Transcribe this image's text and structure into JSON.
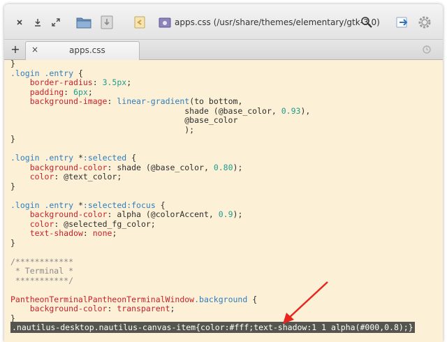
{
  "titlebar": {
    "title": "apps.css (/usr/share/themes/elementary/gtk-3.0)",
    "icons": [
      "close-icon",
      "download-icon",
      "maximize-icon",
      "folder-icon",
      "save-icon",
      "undo-icon",
      "document-icon",
      "search-icon",
      "share-icon",
      "gear-icon"
    ]
  },
  "tabs": {
    "add_label": "+",
    "close_label": "×",
    "active_tab": "apps.css"
  },
  "code_lines": [
    [
      {
        "t": "}",
        "c": "ident"
      }
    ],
    [
      {
        "t": ".login",
        "c": "sel"
      },
      {
        "t": " ",
        "c": "ident"
      },
      {
        "t": ".entry",
        "c": "sel"
      },
      {
        "t": " {",
        "c": "ident"
      }
    ],
    [
      {
        "t": "    ",
        "c": "ident"
      },
      {
        "t": "border-radius",
        "c": "prop"
      },
      {
        "t": ": ",
        "c": "ident"
      },
      {
        "t": "3.5px",
        "c": "num"
      },
      {
        "t": ";",
        "c": "ident"
      }
    ],
    [
      {
        "t": "    ",
        "c": "ident"
      },
      {
        "t": "padding",
        "c": "prop"
      },
      {
        "t": ": ",
        "c": "ident"
      },
      {
        "t": "6px",
        "c": "num"
      },
      {
        "t": ";",
        "c": "ident"
      }
    ],
    [
      {
        "t": "    ",
        "c": "ident"
      },
      {
        "t": "background-image",
        "c": "prop"
      },
      {
        "t": ": ",
        "c": "ident"
      },
      {
        "t": "linear-gradient",
        "c": "fn"
      },
      {
        "t": "(to bottom,",
        "c": "ident"
      }
    ],
    [
      {
        "t": "                                    shade (@base_color, ",
        "c": "ident"
      },
      {
        "t": "0.93",
        "c": "num"
      },
      {
        "t": "),",
        "c": "ident"
      }
    ],
    [
      {
        "t": "                                    @base_color",
        "c": "ident"
      }
    ],
    [
      {
        "t": "                                    );",
        "c": "ident"
      }
    ],
    [
      {
        "t": "}",
        "c": "ident"
      }
    ],
    [
      {
        "t": "",
        "c": "ident"
      }
    ],
    [
      {
        "t": ".login",
        "c": "sel"
      },
      {
        "t": " ",
        "c": "ident"
      },
      {
        "t": ".entry",
        "c": "sel"
      },
      {
        "t": " *",
        "c": "ident"
      },
      {
        "t": ":selected",
        "c": "sel"
      },
      {
        "t": " {",
        "c": "ident"
      }
    ],
    [
      {
        "t": "    ",
        "c": "ident"
      },
      {
        "t": "background-color",
        "c": "prop"
      },
      {
        "t": ": shade (@base_color, ",
        "c": "ident"
      },
      {
        "t": "0.80",
        "c": "num"
      },
      {
        "t": ");",
        "c": "ident"
      }
    ],
    [
      {
        "t": "    ",
        "c": "ident"
      },
      {
        "t": "color",
        "c": "prop"
      },
      {
        "t": ": @text_color;",
        "c": "ident"
      }
    ],
    [
      {
        "t": "}",
        "c": "ident"
      }
    ],
    [
      {
        "t": "",
        "c": "ident"
      }
    ],
    [
      {
        "t": ".login",
        "c": "sel"
      },
      {
        "t": " ",
        "c": "ident"
      },
      {
        "t": ".entry",
        "c": "sel"
      },
      {
        "t": " *",
        "c": "ident"
      },
      {
        "t": ":selected:focus",
        "c": "sel"
      },
      {
        "t": " {",
        "c": "ident"
      }
    ],
    [
      {
        "t": "    ",
        "c": "ident"
      },
      {
        "t": "background-color",
        "c": "prop"
      },
      {
        "t": ": alpha (@colorAccent, ",
        "c": "ident"
      },
      {
        "t": "0.9",
        "c": "num"
      },
      {
        "t": ");",
        "c": "ident"
      }
    ],
    [
      {
        "t": "    ",
        "c": "ident"
      },
      {
        "t": "color",
        "c": "prop"
      },
      {
        "t": ": @selected_fg_color;",
        "c": "ident"
      }
    ],
    [
      {
        "t": "    ",
        "c": "ident"
      },
      {
        "t": "text-shadow",
        "c": "prop"
      },
      {
        "t": ": ",
        "c": "ident"
      },
      {
        "t": "none",
        "c": "kw"
      },
      {
        "t": ";",
        "c": "ident"
      }
    ],
    [
      {
        "t": "}",
        "c": "ident"
      }
    ],
    [
      {
        "t": "",
        "c": "ident"
      }
    ],
    [
      {
        "t": "/************",
        "c": "comment"
      }
    ],
    [
      {
        "t": " * Terminal *",
        "c": "comment"
      }
    ],
    [
      {
        "t": " ***********/",
        "c": "comment"
      }
    ],
    [
      {
        "t": "",
        "c": "ident"
      }
    ],
    [
      {
        "t": "PantheonTerminalPantheonTerminalWindow",
        "c": "kw"
      },
      {
        "t": ".background",
        "c": "sel"
      },
      {
        "t": " {",
        "c": "ident"
      }
    ],
    [
      {
        "t": "    ",
        "c": "ident"
      },
      {
        "t": "background-color",
        "c": "prop"
      },
      {
        "t": ": ",
        "c": "ident"
      },
      {
        "t": "transparent",
        "c": "kw"
      },
      {
        "t": ";",
        "c": "ident"
      }
    ],
    [
      {
        "t": "}",
        "c": "ident"
      }
    ]
  ],
  "highlighted_line": ".nautilus-desktop.nautilus-canvas-item{color:#fff;text-shadow:1 1 alpha(#000,0.8);}",
  "colors": {
    "editor_bg": "#fcf1d6",
    "selector": "#2e7dbf",
    "property": "#c8202a",
    "number": "#1f9b8e",
    "comment": "#8a8a8a",
    "annotation_arrow": "#e8251f"
  }
}
